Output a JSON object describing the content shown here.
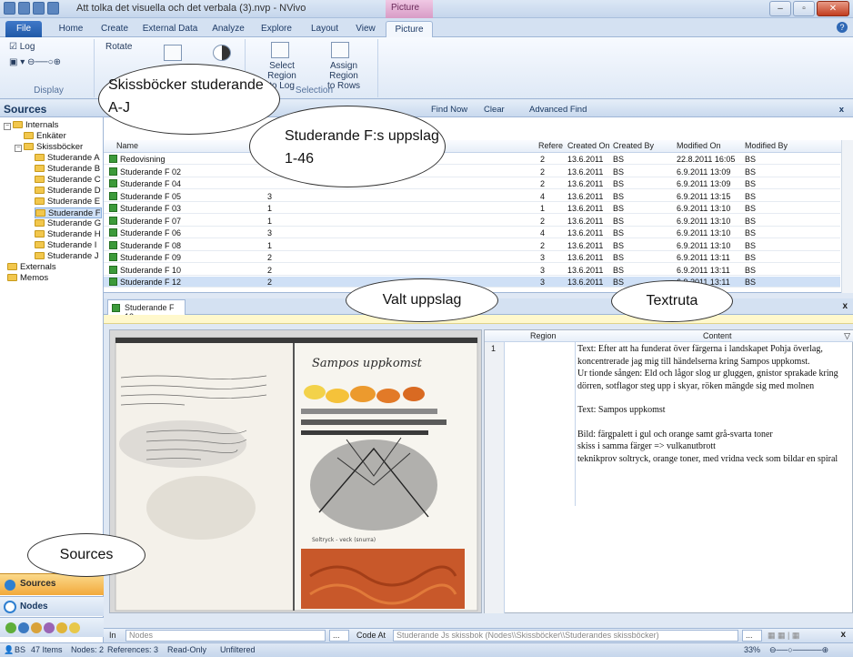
{
  "window": {
    "title": "Att tolka det visuella och det verbala (3).nvp - NVivo",
    "context_tab": "Picture"
  },
  "ribbon": {
    "tabs": [
      "File",
      "Home",
      "Create",
      "External Data",
      "Analyze",
      "Explore",
      "Layout",
      "View",
      "Picture"
    ],
    "groups": {
      "display": {
        "label": "Display",
        "log": "Log",
        "rotate": "Rotate"
      },
      "selection": {
        "label": "Selection",
        "select_region": "Select Region",
        "to_log": "to Log",
        "assign_region": "Assign Region",
        "to_rows": "to Rows"
      }
    }
  },
  "nav": {
    "header": "Sources",
    "tree": {
      "internals": "Internals",
      "enkater": "Enkäter",
      "skissbocker": "Skissböcker",
      "students": [
        "Studerande A",
        "Studerande B",
        "Studerande C",
        "Studerande D",
        "Studerande E",
        "Studerande F",
        "Studerande G",
        "Studerande H",
        "Studerande I",
        "Studerande J"
      ],
      "externals": "Externals",
      "memos": "Memos"
    },
    "buttons": {
      "sources": "Sources",
      "nodes": "Nodes"
    }
  },
  "find_bar": {
    "find_now": "Find Now",
    "clear": "Clear",
    "advanced_find": "Advanced Find",
    "close": "x"
  },
  "list": {
    "columns": {
      "name": "Name",
      "refs": "Refere",
      "created_on": "Created On",
      "created_by": "Created By",
      "modified_on": "Modified On",
      "modified_by": "Modified By"
    },
    "rows": [
      {
        "name": "Redovisning",
        "nodes": "",
        "refs": "2",
        "created_on": "13.6.2011",
        "created_by": "BS",
        "modified_on": "22.8.2011 16:05",
        "modified_by": "BS"
      },
      {
        "name": "Studerande F 02",
        "nodes": "",
        "refs": "2",
        "created_on": "13.6.2011",
        "created_by": "BS",
        "modified_on": "6.9.2011 13:09",
        "modified_by": "BS"
      },
      {
        "name": "Studerande F 04",
        "nodes": "",
        "refs": "2",
        "created_on": "13.6.2011",
        "created_by": "BS",
        "modified_on": "6.9.2011 13:09",
        "modified_by": "BS"
      },
      {
        "name": "Studerande F 05",
        "nodes": "3",
        "refs": "4",
        "created_on": "13.6.2011",
        "created_by": "BS",
        "modified_on": "6.9.2011 13:15",
        "modified_by": "BS"
      },
      {
        "name": "Studerande F 03",
        "nodes": "1",
        "refs": "1",
        "created_on": "13.6.2011",
        "created_by": "BS",
        "modified_on": "6.9.2011 13:10",
        "modified_by": "BS"
      },
      {
        "name": "Studerande F 07",
        "nodes": "1",
        "refs": "2",
        "created_on": "13.6.2011",
        "created_by": "BS",
        "modified_on": "6.9.2011 13:10",
        "modified_by": "BS"
      },
      {
        "name": "Studerande F 06",
        "nodes": "3",
        "refs": "4",
        "created_on": "13.6.2011",
        "created_by": "BS",
        "modified_on": "6.9.2011 13:10",
        "modified_by": "BS"
      },
      {
        "name": "Studerande F 08",
        "nodes": "1",
        "refs": "2",
        "created_on": "13.6.2011",
        "created_by": "BS",
        "modified_on": "6.9.2011 13:10",
        "modified_by": "BS"
      },
      {
        "name": "Studerande F 09",
        "nodes": "2",
        "refs": "3",
        "created_on": "13.6.2011",
        "created_by": "BS",
        "modified_on": "6.9.2011 13:11",
        "modified_by": "BS"
      },
      {
        "name": "Studerande F 10",
        "nodes": "2",
        "refs": "3",
        "created_on": "13.6.2011",
        "created_by": "BS",
        "modified_on": "6.9.2011 13:11",
        "modified_by": "BS"
      },
      {
        "name": "Studerande F 12",
        "nodes": "2",
        "refs": "3",
        "created_on": "13.6.2011",
        "created_by": "BS",
        "modified_on": "6.9.2011 13:11",
        "modified_by": "BS"
      }
    ]
  },
  "detail": {
    "tab": "Studerande F 12",
    "close": "x",
    "region_header": "Region",
    "content_header": "Content",
    "row_number": "1",
    "content_lines": [
      "Text: Efter att ha funderat över färgerna i landskapet Pohja överlag, koncentrerade jag mig till händelserna kring Sampos uppkomst.",
      "Ur tionde sången: Eld och lågor slog ur gluggen, gnistor sprakade kring dörren, sotflagor steg upp i skyar, röken mängde sig med molnen",
      "",
      "Text: Sampos uppkomst",
      "",
      "Bild: färgpalett i gul och orange samt grå-svarta toner",
      "skiss i samma färger => vulkanutbrott",
      "teknikprov soltryck, orange toner, med vridna veck som bildar en spiral"
    ],
    "sketch_heading": "Sampos uppkomst"
  },
  "codebar": {
    "in_label": "In",
    "in_value": "Nodes",
    "browse": "...",
    "code_at_label": "Code At",
    "code_at_value": "Studerande Js skissbok (Nodes\\\\Skissböcker\\\\Studerandes skissböcker)"
  },
  "status": {
    "user": "BS",
    "items": "47 Items",
    "nodes": "Nodes: 2",
    "references": "References: 3",
    "readonly": "Read-Only",
    "filter": "Unfiltered",
    "zoom": "33%"
  },
  "callouts": {
    "skissbocker": "Skissböcker studerande A-J",
    "uppslag": "Studerande F:s uppslag 1-46",
    "valt": "Valt uppslag",
    "textruta": "Textruta",
    "sources": "Sources"
  }
}
